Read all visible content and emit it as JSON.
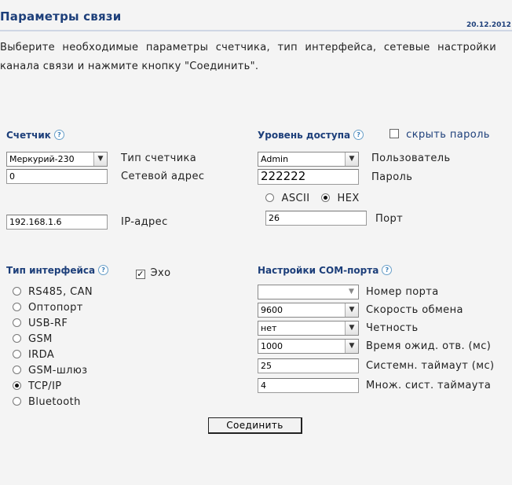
{
  "header": {
    "title": "Параметры связи",
    "date": "20.12.2012"
  },
  "intro": "Выберите необходимые параметры счетчика, тип интерфейса, сетевые настройки канала связи и нажмите кнопку \"Соединить\".",
  "meter": {
    "heading": "Счетчик",
    "help": "?",
    "type_value": "Меркурий-230",
    "type_label": "Тип счетчика",
    "address_value": "0",
    "address_label": "Сетевой адрес",
    "ip_value": "192.168.1.6",
    "ip_label": "IP-адрес"
  },
  "access": {
    "heading": "Уровень доступа",
    "help": "?",
    "hide_password_label": "скрыть пароль",
    "hide_password_checked": false,
    "user_value": "Admin",
    "user_label": "Пользователь",
    "password_value": "222222",
    "password_label": "Пароль",
    "encoding_ascii": "ASCII",
    "encoding_hex": "HEX",
    "encoding_selected": "HEX",
    "port_value": "26",
    "port_label": "Порт"
  },
  "interface": {
    "heading": "Тип интерфейса",
    "help": "?",
    "echo_label": "Эхо",
    "echo_checked": true,
    "options": [
      "RS485, CAN",
      "Оптопорт",
      "USB-RF",
      "GSM",
      "IRDA",
      "GSM-шлюз",
      "TCP/IP",
      "Bluetooth"
    ],
    "selected": "TCP/IP"
  },
  "com": {
    "heading": "Настройки COM-порта",
    "help": "?",
    "port_number_value": "",
    "port_number_label": "Номер порта",
    "baud_value": "9600",
    "baud_label": "Скорость обмена",
    "parity_value": "нет",
    "parity_label": "Четность",
    "wait_value": "1000",
    "wait_label": "Время ожид. отв. (мс)",
    "sys_timeout_value": "25",
    "sys_timeout_label": "Системн. таймаут (мс)",
    "multiplier_value": "4",
    "multiplier_label": "Множ. сист. таймаута"
  },
  "actions": {
    "connect_label": "Соединить"
  },
  "icons": {
    "dropdown_arrow": "chevron-down-icon",
    "help": "help-icon"
  }
}
